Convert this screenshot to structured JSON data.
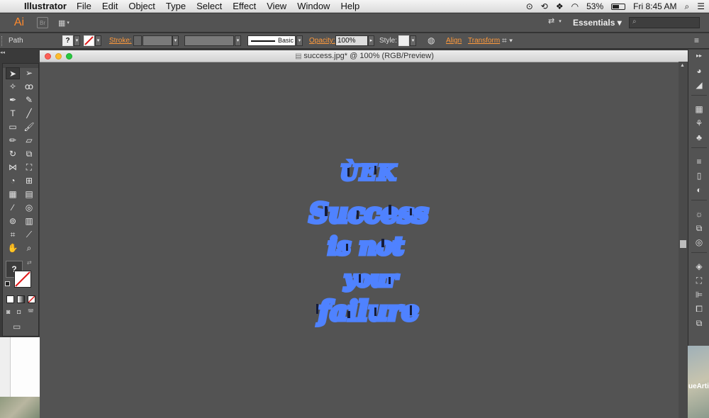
{
  "menubar": {
    "app_name": "Illustrator",
    "items": [
      "File",
      "Edit",
      "Object",
      "Type",
      "Select",
      "Effect",
      "View",
      "Window",
      "Help"
    ],
    "battery": "53%",
    "clock": "Fri 8:45 AM"
  },
  "appbar": {
    "logo": "Ai",
    "bridge": "Br",
    "workspace": "Essentials",
    "search_placeholder": ""
  },
  "controlbar": {
    "selection_type": "Path",
    "fill_value": "?",
    "stroke_label": "Stroke:",
    "brush_label": "Basic",
    "opacity_label": "Opacity:",
    "opacity_value": "100%",
    "style_label": "Style:",
    "align_label": "Align",
    "transform_label": "Transform"
  },
  "document": {
    "title": "success.jpg* @ 100% (RGB/Preview)"
  },
  "artwork": {
    "lines": [
      "ÙEK",
      "Success",
      "is not",
      "your",
      "failure"
    ],
    "fill_color": "#4f82ff",
    "shadow_color": "#151c3a"
  },
  "toolbar": {
    "fill_question": "?"
  },
  "background": {
    "right_text": "ueArti"
  },
  "colors": {
    "ui_dark": "#535353",
    "canvas": "#535353",
    "accent_orange": "#ff9a3c"
  }
}
